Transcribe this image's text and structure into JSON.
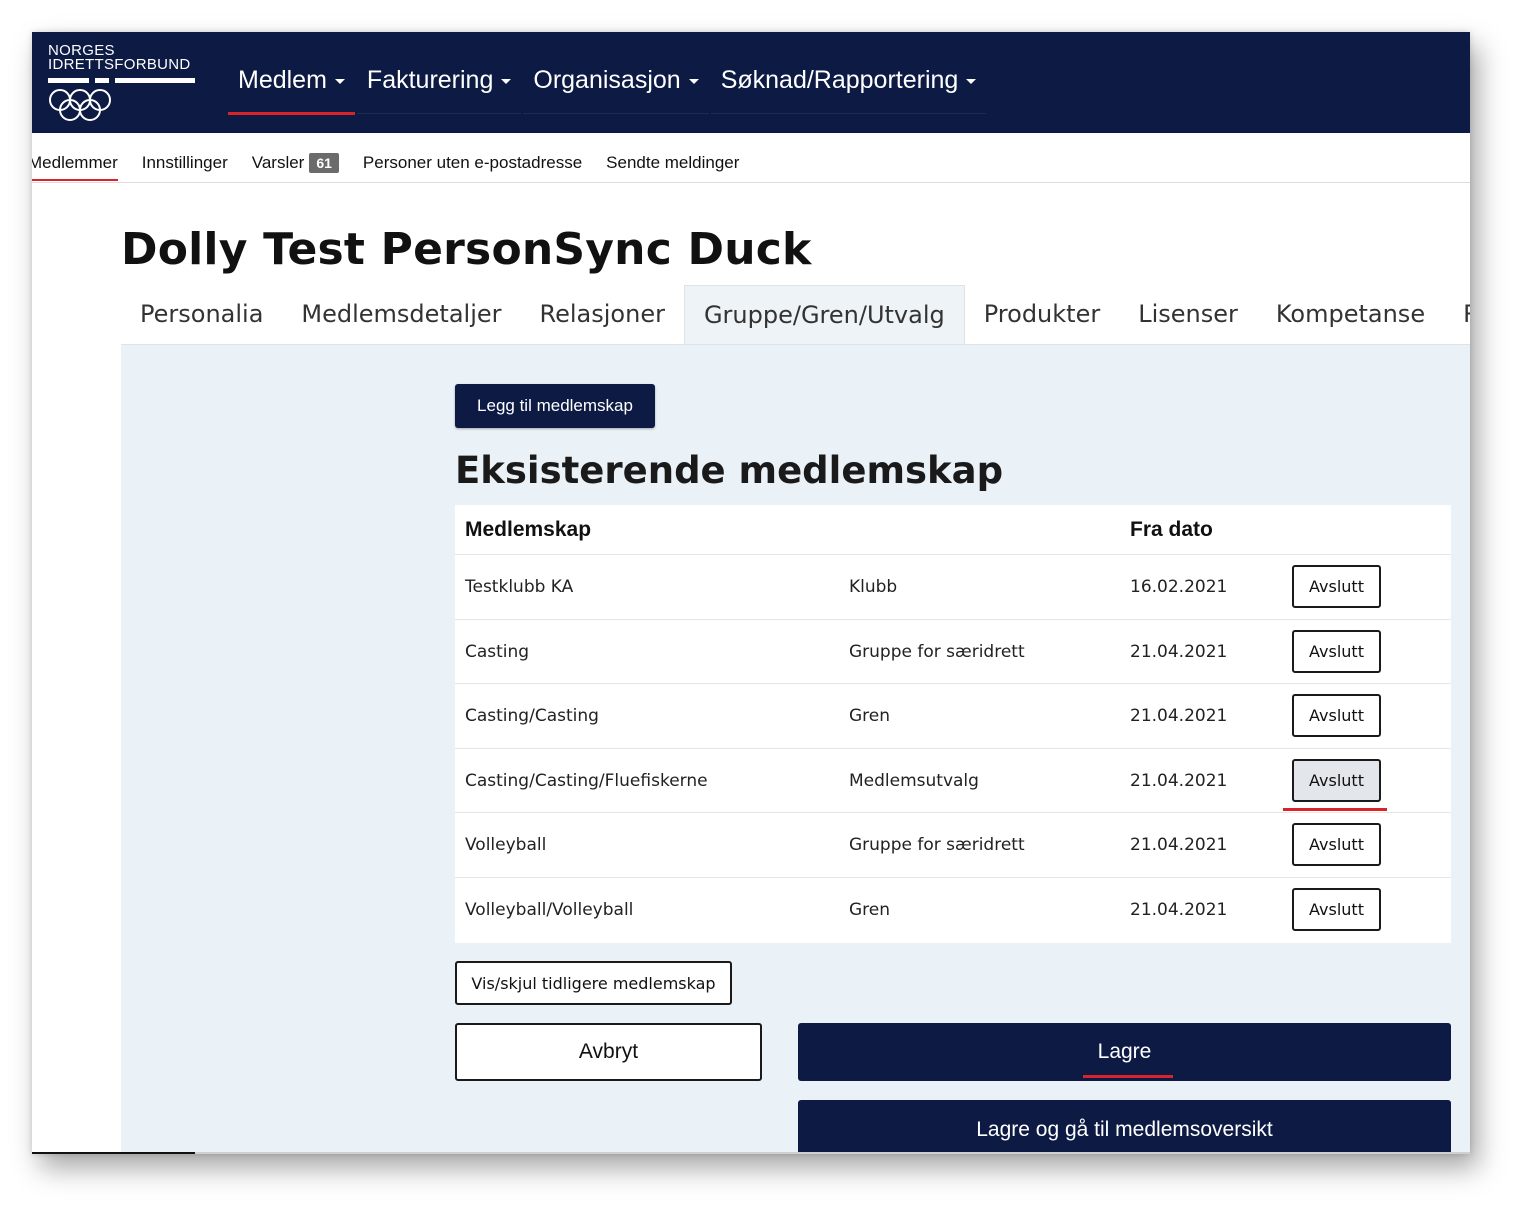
{
  "logo": {
    "line1": "NORGES",
    "line2": "IDRETTSFORBUND"
  },
  "main_nav": {
    "items": [
      {
        "label": "Medlem"
      },
      {
        "label": "Fakturering"
      },
      {
        "label": "Organisasjon"
      },
      {
        "label": "Søknad/Rapportering"
      }
    ]
  },
  "sub_nav": {
    "items": [
      {
        "label": "Medlemmer"
      },
      {
        "label": "Innstillinger"
      },
      {
        "label": "Varsler",
        "badge": "61"
      },
      {
        "label": "Personer uten e-postadresse"
      },
      {
        "label": "Sendte meldinger"
      }
    ]
  },
  "page": {
    "title": "Dolly Test PersonSync Duck"
  },
  "tabs": [
    {
      "label": "Personalia"
    },
    {
      "label": "Medlemsdetaljer"
    },
    {
      "label": "Relasjoner"
    },
    {
      "label": "Gruppe/Gren/Utvalg"
    },
    {
      "label": "Produkter"
    },
    {
      "label": "Lisenser"
    },
    {
      "label": "Kompetanse"
    },
    {
      "label": "Re"
    }
  ],
  "content": {
    "add_button": "Legg til medlemskap",
    "section_title": "Eksisterende medlemskap",
    "table": {
      "headers": {
        "membership": "Medlemskap",
        "type": "",
        "from_date": "Fra dato"
      },
      "rows": [
        {
          "name": "Testklubb KA",
          "type": "Klubb",
          "date": "16.02.2021",
          "action": "Avslutt"
        },
        {
          "name": "Casting",
          "type": "Gruppe for særidrett",
          "date": "21.04.2021",
          "action": "Avslutt"
        },
        {
          "name": "Casting/Casting",
          "type": "Gren",
          "date": "21.04.2021",
          "action": "Avslutt"
        },
        {
          "name": "Casting/Casting/Fluefiskerne",
          "type": "Medlemsutvalg",
          "date": "21.04.2021",
          "action": "Avslutt"
        },
        {
          "name": "Volleyball",
          "type": "Gruppe for særidrett",
          "date": "21.04.2021",
          "action": "Avslutt"
        },
        {
          "name": "Volleyball/Volleyball",
          "type": "Gren",
          "date": "21.04.2021",
          "action": "Avslutt"
        }
      ]
    },
    "toggle_previous": "Vis/skjul tidligere medlemskap",
    "cancel_button": "Avbryt",
    "save_button": "Lagre",
    "save_go_button": "Lagre og gå til medlemsoversikt"
  },
  "colors": {
    "navbar": "#0c1a44",
    "accent_red": "#d8232a",
    "panel_bg": "#eaf1f7"
  }
}
